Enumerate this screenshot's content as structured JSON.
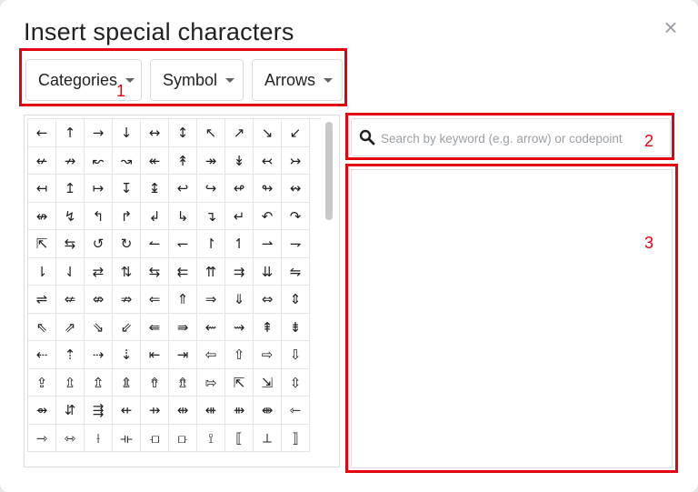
{
  "dialog": {
    "title": "Insert special characters",
    "close_label": "×"
  },
  "toolbar": {
    "categories_label": "Categories",
    "type_label": "Symbol",
    "subcategory_label": "Arrows"
  },
  "search": {
    "placeholder": "Search by keyword (e.g. arrow) or codepoint"
  },
  "annotations": [
    "1",
    "2",
    "3"
  ],
  "annotation_color": "#e3000f",
  "icons": {
    "close": "close-icon",
    "dropdown": "caret-down-icon",
    "search": "search-icon"
  },
  "symbols": [
    [
      "←",
      "↑",
      "→",
      "↓",
      "↔",
      "↕",
      "↖",
      "↗",
      "↘",
      "↙"
    ],
    [
      "↚",
      "↛",
      "↜",
      "↝",
      "↞",
      "↟",
      "↠",
      "↡",
      "↢",
      "↣"
    ],
    [
      "↤",
      "↥",
      "↦",
      "↧",
      "↨",
      "↩",
      "↪",
      "↫",
      "↬",
      "↭"
    ],
    [
      "↮",
      "↯",
      "↰",
      "↱",
      "↲",
      "↳",
      "↴",
      "↵",
      "↶",
      "↷"
    ],
    [
      "⇱",
      "⇆",
      "↺",
      "↻",
      "↼",
      "↽",
      "↾",
      "↿",
      "⇀",
      "⇁"
    ],
    [
      "⇂",
      "⇃",
      "⇄",
      "⇅",
      "⇆",
      "⇇",
      "⇈",
      "⇉",
      "⇊",
      "⇋"
    ],
    [
      "⇌",
      "⇍",
      "⇎",
      "⇏",
      "⇐",
      "⇑",
      "⇒",
      "⇓",
      "⇔",
      "⇕"
    ],
    [
      "⇖",
      "⇗",
      "⇘",
      "⇙",
      "⇚",
      "⇛",
      "⇜",
      "⇝",
      "⇞",
      "⇟"
    ],
    [
      "⇠",
      "⇡",
      "⇢",
      "⇣",
      "⇤",
      "⇥",
      "⇦",
      "⇧",
      "⇨",
      "⇩"
    ],
    [
      "⇪",
      "⇫",
      "⇬",
      "⇭",
      "⇮",
      "⇯",
      "⇰",
      "⇱",
      "⇲",
      "⇳"
    ],
    [
      "⇴",
      "⇵",
      "⇶",
      "⇷",
      "⇸",
      "⇹",
      "⇺",
      "⇻",
      "⇼",
      "⇽"
    ],
    [
      "⇾",
      "⇿",
      "⟊",
      "⟛",
      "⟤",
      "⟥",
      "⟟",
      "⟦",
      "⟂",
      "⟧"
    ]
  ]
}
